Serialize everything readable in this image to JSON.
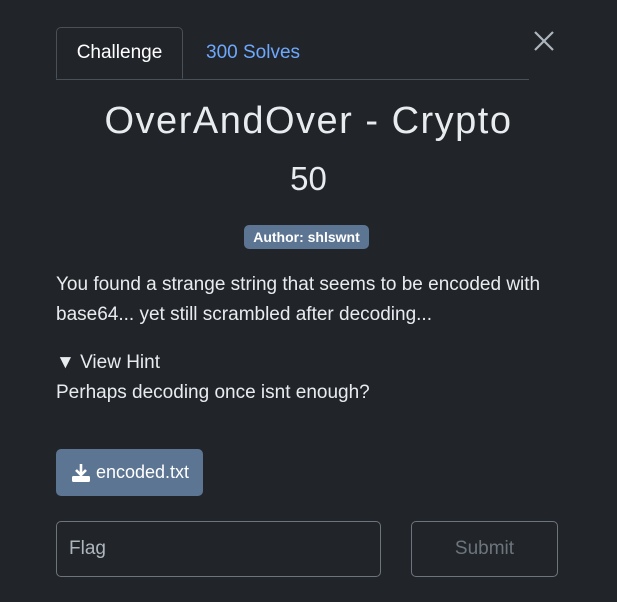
{
  "tabs": {
    "challenge": "Challenge",
    "solves": "300 Solves"
  },
  "challenge": {
    "title": "OverAndOver - Crypto",
    "points": "50",
    "author_badge": "Author: shlswnt",
    "description": "You found a strange string that seems to be encoded with base64... yet still scrambled after decoding...",
    "hint_toggle": "▼ View Hint",
    "hint_text": "Perhaps decoding once isnt enough?",
    "file_name": "encoded.txt"
  },
  "form": {
    "flag_placeholder": "Flag",
    "submit_label": "Submit"
  },
  "colors": {
    "background": "#212529",
    "badge": "#5c7592",
    "link": "#6ea8fe"
  }
}
